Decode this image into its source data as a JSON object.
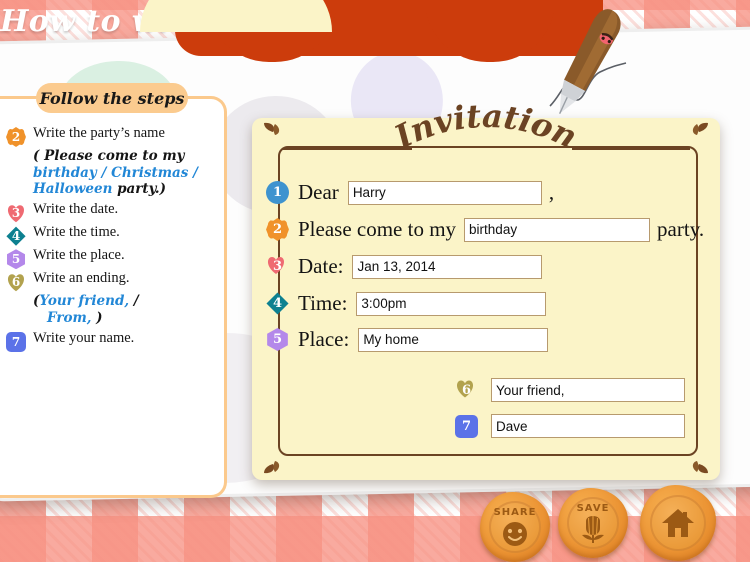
{
  "banner": {
    "title": "How to write an Invitation?",
    "color": "#cc3c0c"
  },
  "sidebar": {
    "heading": "Follow the steps",
    "steps": [
      {
        "num": "2",
        "shape": "flower",
        "color": "#f0922a",
        "text": "Write the party’s name"
      },
      {
        "num": "3",
        "shape": "heart",
        "color": "#ef6a72",
        "text": "Write the date."
      },
      {
        "num": "4",
        "shape": "diamond",
        "color": "#0d8090",
        "text": "Write the time."
      },
      {
        "num": "5",
        "shape": "hexagon",
        "color": "#b488ea",
        "text": "Write the place."
      },
      {
        "num": "6",
        "shape": "hexagon",
        "color": "#b2a24e",
        "text": "Write an ending."
      },
      {
        "num": "7",
        "shape": "square",
        "color": "#5b72e8",
        "text": "Write your name."
      }
    ],
    "step2_example": {
      "open": "( ",
      "lead": "Please come to my ",
      "options": "birthday / Christmas / Halloween",
      "tail": " party.)"
    },
    "step6_example": {
      "open": "(",
      "line1": "Your friend,",
      "sep": " / ",
      "line2": "From,",
      "close": " )"
    }
  },
  "card": {
    "title": "Invitation",
    "rows": [
      {
        "num": "1",
        "shape": "circle",
        "color": "#3e93cf",
        "label": "Dear",
        "value": "Harry",
        "tail": ","
      },
      {
        "num": "2",
        "shape": "flower",
        "color": "#f0922a",
        "label": "Please come to my",
        "value": "birthday",
        "tail": "party."
      },
      {
        "num": "3",
        "shape": "heart",
        "color": "#ef6a72",
        "label": "Date:",
        "value": "Jan 13, 2014",
        "tail": ""
      },
      {
        "num": "4",
        "shape": "diamond",
        "color": "#0d8090",
        "label": "Time:",
        "value": "3:00pm",
        "tail": ""
      },
      {
        "num": "5",
        "shape": "hexagon",
        "color": "#b488ea",
        "label": "Place:",
        "value": "My home",
        "tail": ""
      },
      {
        "num": "6",
        "shape": "hexagon",
        "color": "#b2a24e",
        "label": "",
        "value": "Your friend,",
        "tail": ""
      },
      {
        "num": "7",
        "shape": "square",
        "color": "#5b72e8",
        "label": "",
        "value": "Dave",
        "tail": ""
      }
    ]
  },
  "buttons": [
    {
      "name": "share-button",
      "caption": "SHARE",
      "icon": "smiley-face-icon"
    },
    {
      "name": "save-button",
      "caption": "SAVE",
      "icon": "tulip-flower-icon"
    },
    {
      "name": "home-button",
      "caption": "",
      "icon": "house-icon"
    }
  ],
  "decor": {
    "pen": "quill-pen-icon",
    "ink": "ink-squiggle-icon"
  }
}
